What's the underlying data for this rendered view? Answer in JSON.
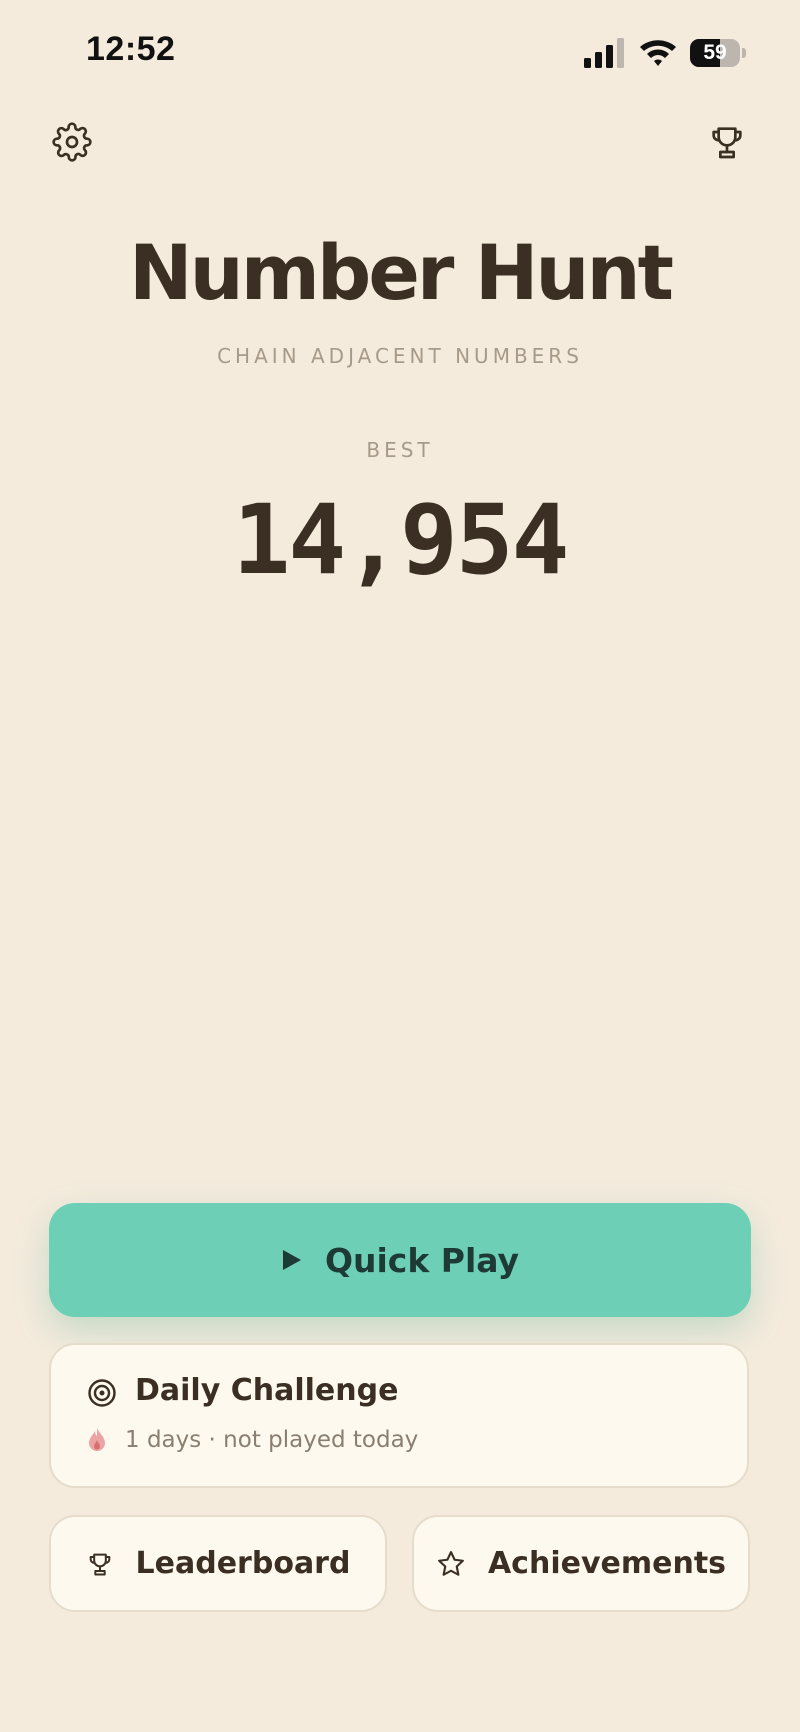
{
  "status_bar": {
    "time": "12:52",
    "battery_level": "59",
    "battery_fraction": 0.59
  },
  "header": {
    "settings_icon": "gear-icon",
    "trophy_icon": "trophy-icon"
  },
  "app": {
    "title": "Number Hunt",
    "subtitle": "CHAIN ADJACENT NUMBERS"
  },
  "best": {
    "label": "BEST",
    "score": "14,954"
  },
  "quick_play": {
    "label": "Quick Play",
    "icon": "play-icon",
    "color": "#6DCFB6"
  },
  "daily_challenge": {
    "title": "Daily Challenge",
    "icon": "target-icon",
    "streak_icon": "flame-icon",
    "status": "1 days · not played today"
  },
  "leaderboard": {
    "label": "Leaderboard",
    "icon": "trophy-icon"
  },
  "achievements": {
    "label": "Achievements",
    "icon": "star-icon"
  },
  "colors": {
    "background": "#F4EBDD",
    "text": "#3A2F22",
    "muted": "#A89A88",
    "card": "#FDF9EE",
    "accent": "#6DCFB6"
  }
}
